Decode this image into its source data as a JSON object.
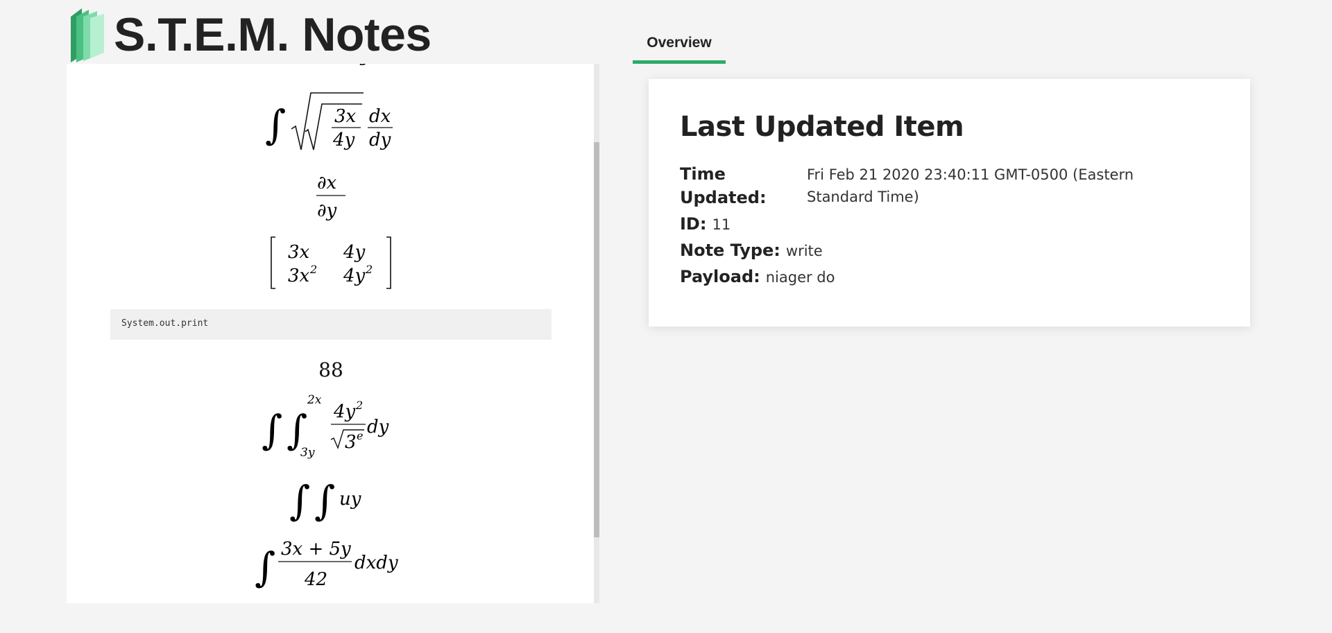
{
  "app": {
    "title": "S.T.E.M. Notes",
    "logo_icon": "book-stack-icon",
    "accent_color": "#2eaa6a"
  },
  "tabs": [
    {
      "label": "Overview",
      "active": true
    }
  ],
  "notes": {
    "code_snippet": "System.out.print",
    "number_value": "88"
  },
  "last_updated": {
    "heading": "Last Updated Item",
    "time_label": "Time Updated:",
    "time_value": "Fri Feb 21 2020 23:40:11 GMT-0500 (Eastern Standard Time)",
    "id_label": "ID:",
    "id_value": "11",
    "note_type_label": "Note Type:",
    "note_type_value": "write",
    "payload_label": "Payload:",
    "payload_value": "niager do"
  }
}
